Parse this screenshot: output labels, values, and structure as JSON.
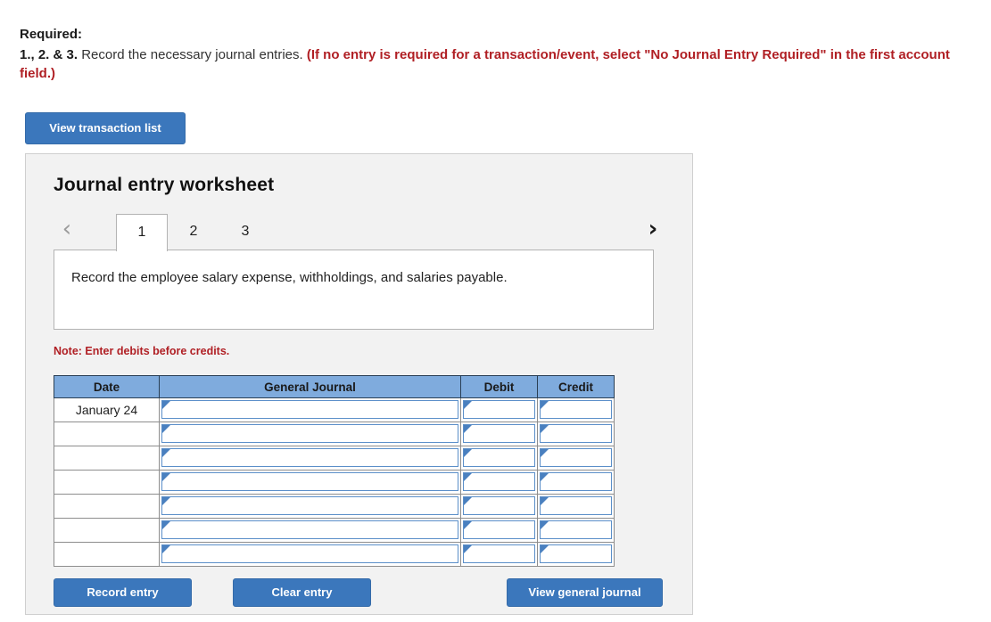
{
  "prompt": {
    "required_label": "Required:",
    "numbering": "1., 2. & 3.",
    "instruction": " Record the necessary journal entries. ",
    "red_note": "(If no entry is required for a transaction/event, select \"No Journal Entry Required\" in the first account field.)"
  },
  "toolbar": {
    "view_transaction_list": "View transaction list"
  },
  "worksheet": {
    "title": "Journal entry worksheet",
    "prev_arrow": "‹",
    "next_arrow": "›",
    "tabs": [
      {
        "label": "1",
        "active": true
      },
      {
        "label": "2",
        "active": false
      },
      {
        "label": "3",
        "active": false
      }
    ],
    "transaction_description": "Record the employee salary expense, withholdings, and salaries payable.",
    "note": "Note: Enter debits before credits."
  },
  "journal_table": {
    "headers": [
      "Date",
      "General Journal",
      "Debit",
      "Credit"
    ],
    "rows": [
      {
        "date": "January 24",
        "general_journal": "",
        "debit": "",
        "credit": ""
      },
      {
        "date": "",
        "general_journal": "",
        "debit": "",
        "credit": ""
      },
      {
        "date": "",
        "general_journal": "",
        "debit": "",
        "credit": ""
      },
      {
        "date": "",
        "general_journal": "",
        "debit": "",
        "credit": ""
      },
      {
        "date": "",
        "general_journal": "",
        "debit": "",
        "credit": ""
      },
      {
        "date": "",
        "general_journal": "",
        "debit": "",
        "credit": ""
      },
      {
        "date": "",
        "general_journal": "",
        "debit": "",
        "credit": ""
      }
    ]
  },
  "footer": {
    "record_entry": "Record entry",
    "clear_entry": "Clear entry",
    "view_general_journal": "View general journal"
  },
  "colors": {
    "button_blue": "#3b77bc",
    "table_header_blue": "#7fabdd",
    "alert_red": "#b01f24",
    "panel_gray": "#f2f2f2",
    "cell_border_blue": "#5b8fc9"
  }
}
